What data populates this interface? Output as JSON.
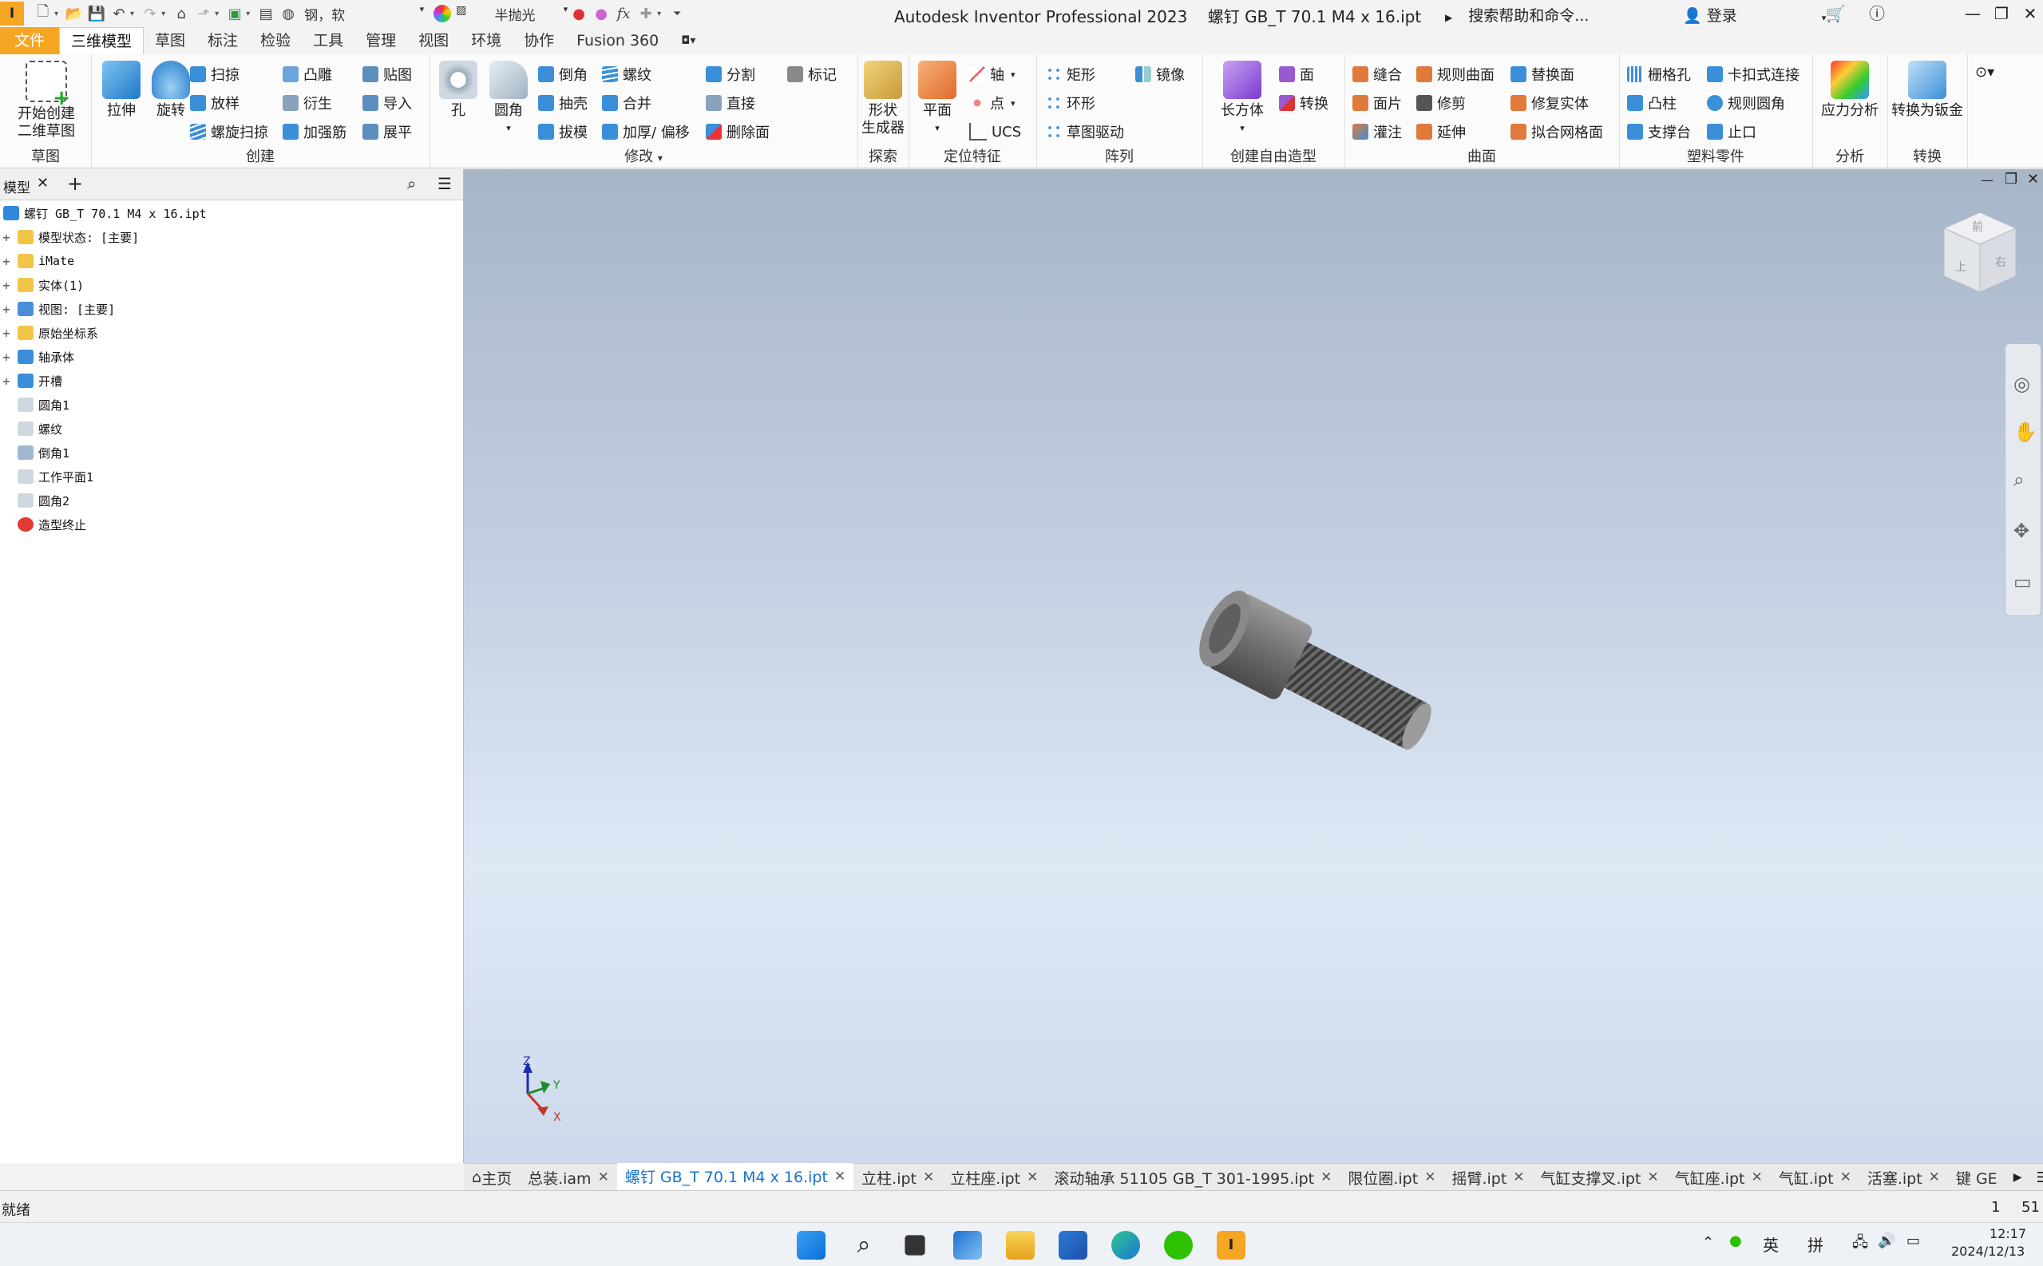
{
  "titlebar": {
    "material": "钢，软",
    "appearance": "半抛光",
    "title": "Autodesk Inventor Professional 2023",
    "filename": "螺钉 GB_T 70.1 M4 x 16.ipt",
    "help_search": "搜索帮助和命令...",
    "login": "登录"
  },
  "tabs": [
    "文件",
    "三维模型",
    "草图",
    "标注",
    "检验",
    "工具",
    "管理",
    "视图",
    "环境",
    "协作",
    "Fusion 360"
  ],
  "ribbon": {
    "sketch": {
      "label": "草图",
      "start": "开始创建",
      "start2": "二维草图"
    },
    "create": {
      "label": "创建",
      "extrude": "拉伸",
      "revolve": "旋转",
      "sweep": "扫掠",
      "loft": "放样",
      "coil": "螺旋扫掠",
      "emboss": "凸雕",
      "derive": "衍生",
      "rib": "加强筋",
      "decal": "贴图",
      "import": "导入",
      "unfold": "展平"
    },
    "modify": {
      "label": "修改",
      "hole": "孔",
      "fillet": "圆角",
      "chamfer": "倒角",
      "shell": "抽壳",
      "draft": "拔模",
      "thread": "螺纹",
      "combine": "合并",
      "thicken": "加厚/ 偏移",
      "split": "分割",
      "direct": "直接",
      "delete_face": "删除面",
      "mark": "标记"
    },
    "explore": {
      "label": "探索",
      "shape_gen": "形状",
      "shape_gen2": "生成器"
    },
    "work": {
      "label": "定位特征",
      "plane": "平面",
      "axis": "轴",
      "point": "点",
      "ucs": "UCS"
    },
    "pattern": {
      "label": "阵列",
      "rect": "矩形",
      "circ": "环形",
      "sketch_driven": "草图驱动",
      "mirror": "镜像"
    },
    "freeform": {
      "label": "创建自由造型",
      "box": "长方体",
      "face": "面",
      "convert": "转换"
    },
    "surface": {
      "label": "曲面",
      "stitch": "缝合",
      "patch": "面片",
      "sculpt": "灌注",
      "ruled": "规则曲面",
      "trim": "修剪",
      "extend": "延伸",
      "replace": "替换面",
      "repair": "修复实体",
      "fit_mesh": "拟合网格面"
    },
    "plastic": {
      "label": "塑料零件",
      "grill": "栅格孔",
      "boss": "凸柱",
      "rest": "支撑台",
      "snap": "卡扣式连接",
      "rule_fillet": "规则圆角",
      "lip": "止口"
    },
    "analysis": {
      "label": "分析",
      "stress": "应力分析"
    },
    "convert": {
      "label": "转换",
      "sheetmetal": "转换为钣金"
    }
  },
  "browser": {
    "tab_label": "模型",
    "root": "螺钉 GB_T 70.1 M4 x 16.ipt",
    "items": [
      {
        "label": "模型状态: [主要]",
        "expand": "+"
      },
      {
        "label": "iMate",
        "expand": "+"
      },
      {
        "label": "实体(1)",
        "expand": "+"
      },
      {
        "label": "视图: [主要]",
        "expand": "+"
      },
      {
        "label": "原始坐标系",
        "expand": "+"
      },
      {
        "label": "轴承体",
        "expand": "+"
      },
      {
        "label": "开槽",
        "expand": "+"
      },
      {
        "label": "圆角1",
        "expand": ""
      },
      {
        "label": "螺纹",
        "expand": ""
      },
      {
        "label": "倒角1",
        "expand": ""
      },
      {
        "label": "工作平面1",
        "expand": ""
      },
      {
        "label": "圆角2",
        "expand": ""
      },
      {
        "label": "造型终止",
        "expand": ""
      }
    ]
  },
  "viewcube": {
    "top": "前",
    "right": "右",
    "left": "上"
  },
  "triad": {
    "x": "X",
    "y": "Y",
    "z": "Z"
  },
  "doctabs": [
    {
      "label": "主页",
      "close": false
    },
    {
      "label": "总装.iam",
      "close": true
    },
    {
      "label": "螺钉 GB_T 70.1 M4 x 16.ipt",
      "close": true,
      "active": true
    },
    {
      "label": "立柱.ipt",
      "close": true
    },
    {
      "label": "立柱座.ipt",
      "close": true
    },
    {
      "label": "滚动轴承 51105 GB_T 301-1995.ipt",
      "close": true
    },
    {
      "label": "限位圈.ipt",
      "close": true
    },
    {
      "label": "摇臂.ipt",
      "close": true
    },
    {
      "label": "气缸支撑叉.ipt",
      "close": true
    },
    {
      "label": "气缸座.ipt",
      "close": true
    },
    {
      "label": "气缸.ipt",
      "close": true
    },
    {
      "label": "活塞.ipt",
      "close": true
    },
    {
      "label": "键 GE",
      "close": false
    }
  ],
  "status": {
    "text": "就绪",
    "n1": "1",
    "n2": "51"
  },
  "taskbar": {
    "ime1": "英",
    "ime2": "拼",
    "time": "12:17",
    "date": "2024/12/13"
  },
  "colors": {
    "accent": "#f5a623",
    "active_tab": "#1a73c8",
    "viewport_top": "#a7b5c9",
    "viewport_bottom": "#dfe8f5"
  }
}
